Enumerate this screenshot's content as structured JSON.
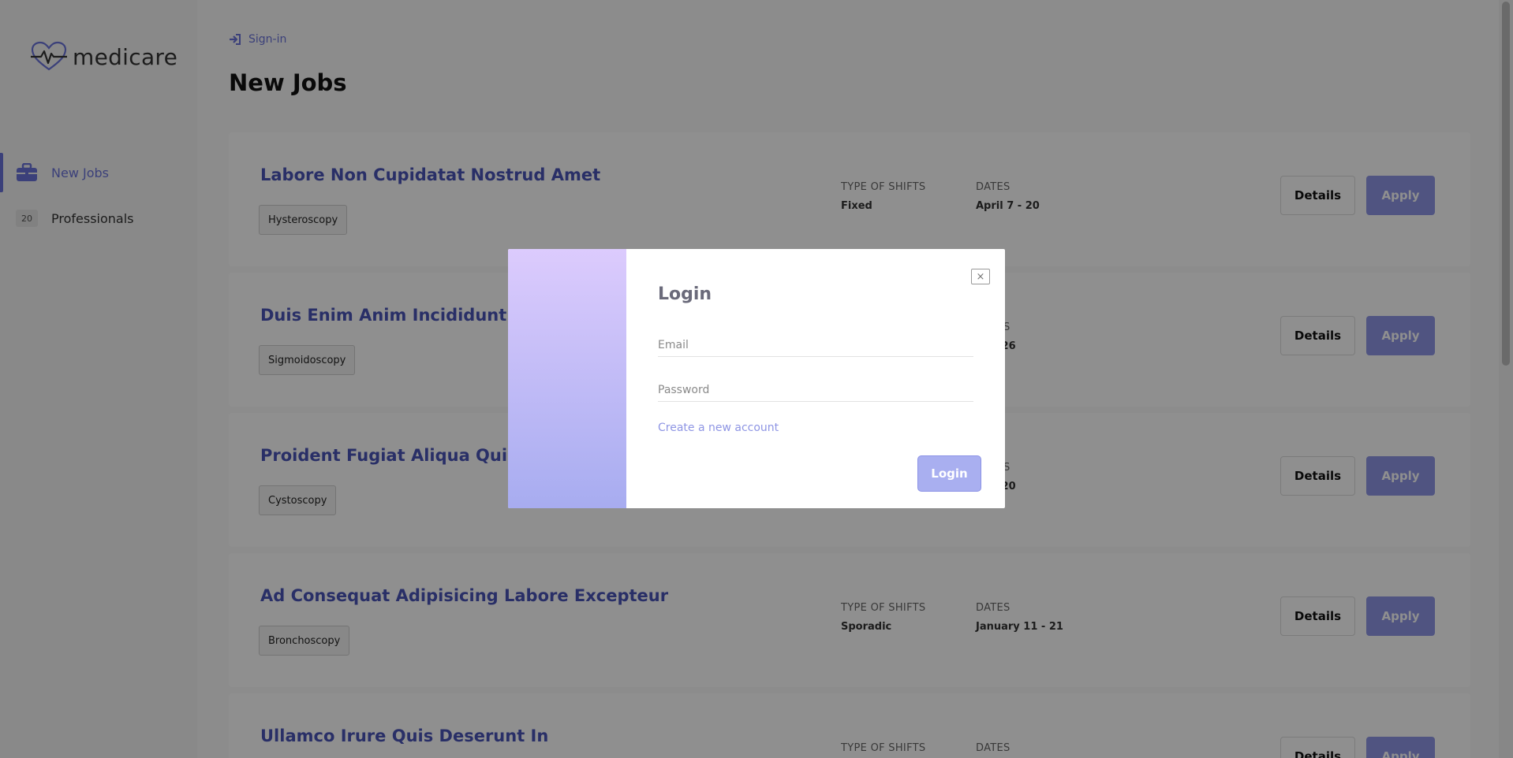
{
  "brand": {
    "name": "medicare",
    "accent": "#6a73d9",
    "apply_color": "#8f97e6"
  },
  "sidebar": {
    "items": [
      {
        "label": "New Jobs",
        "icon": "briefcase-icon",
        "active": true
      },
      {
        "label": "Professionals",
        "badge": "20",
        "active": false
      }
    ]
  },
  "header": {
    "signin_label": "Sign-in",
    "signin_icon": "sign-in-icon"
  },
  "page": {
    "title": "New Jobs"
  },
  "labels": {
    "shift_type": "TYPE OF SHIFTS",
    "dates": "DATES",
    "details": "Details",
    "apply": "Apply"
  },
  "jobs": [
    {
      "title": "Labore Non Cupidatat Nostrud Amet",
      "tag": "Hysteroscopy",
      "shift": "Fixed",
      "dates": "April 7 - 20"
    },
    {
      "title": "Duis Enim Anim Incididunt Rep",
      "tag": "Sigmoidoscopy",
      "shift": "",
      "dates": "13 - 26"
    },
    {
      "title": "Proident Fugiat Aliqua Quis Iru",
      "tag": "Cystoscopy",
      "shift": "",
      "dates": "10 - 20"
    },
    {
      "title": "Ad Consequat Adipisicing Labore Excepteur",
      "tag": "Bronchoscopy",
      "shift": "Sporadic",
      "dates": "January 11 - 21"
    },
    {
      "title": "Ullamco Irure Quis Deserunt In",
      "tag": "",
      "shift": "",
      "dates": ""
    }
  ],
  "modal": {
    "title": "Login",
    "close_symbol": "×",
    "email_placeholder": "Email",
    "password_placeholder": "Password",
    "create_account_link": "Create a new account",
    "submit_label": "Login"
  }
}
